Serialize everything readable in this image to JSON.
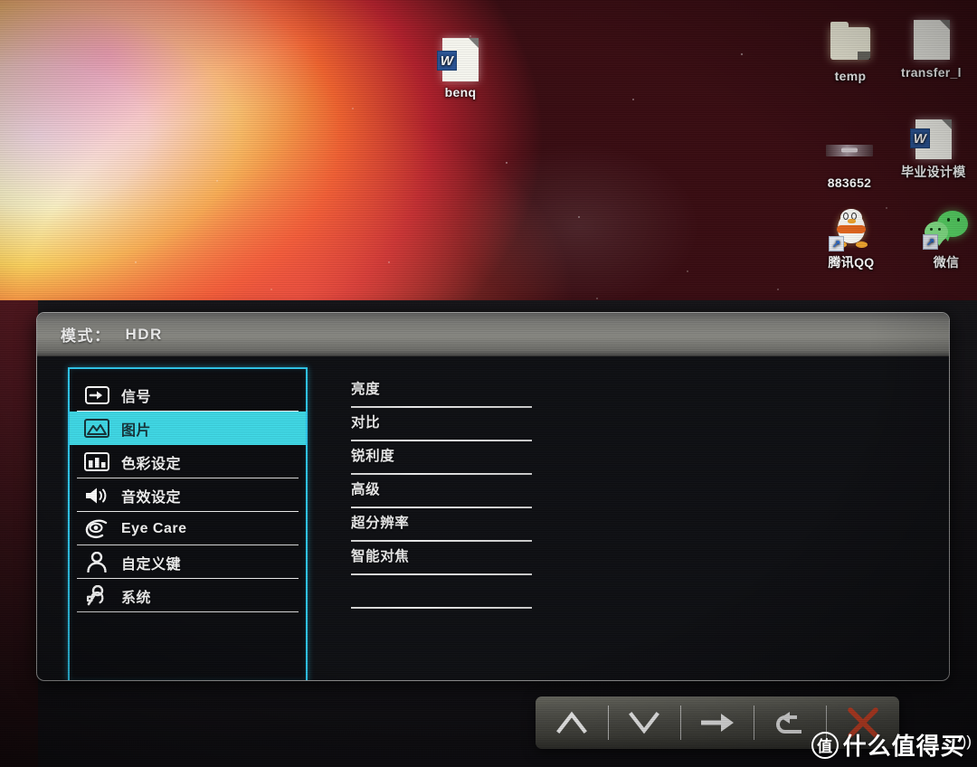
{
  "desktop": {
    "icons": [
      {
        "name": "benq",
        "label": "benq",
        "type": "word-document"
      },
      {
        "name": "temp",
        "label": "temp",
        "type": "folder"
      },
      {
        "name": "transfer",
        "label": "transfer_l",
        "type": "file"
      },
      {
        "name": "883652",
        "label": "883652",
        "type": "file-thin"
      },
      {
        "name": "graduation-doc",
        "label": "毕业设计模",
        "type": "word-document"
      },
      {
        "name": "tencent-qq",
        "label": "腾讯QQ",
        "type": "app-shortcut"
      },
      {
        "name": "wechat",
        "label": "微信",
        "type": "app-shortcut"
      }
    ]
  },
  "osd": {
    "title_label": "模式：",
    "title_value": "HDR",
    "accent_color": "#2fc9ef",
    "highlight_color": "#3fdcea",
    "sidebar": [
      {
        "label": "信号",
        "icon": "signal-icon",
        "selected": false
      },
      {
        "label": "图片",
        "icon": "picture-icon",
        "selected": true
      },
      {
        "label": "色彩设定",
        "icon": "color-settings-icon",
        "selected": false
      },
      {
        "label": "音效设定",
        "icon": "audio-settings-icon",
        "selected": false
      },
      {
        "label": "Eye Care",
        "icon": "eye-care-icon",
        "selected": false
      },
      {
        "label": "自定义键",
        "icon": "custom-key-icon",
        "selected": false
      },
      {
        "label": "系统",
        "icon": "system-wrench-icon",
        "selected": false
      }
    ],
    "options": [
      {
        "label": "亮度"
      },
      {
        "label": "对比"
      },
      {
        "label": "锐利度"
      },
      {
        "label": "高级"
      },
      {
        "label": "超分辨率"
      },
      {
        "label": "智能对焦"
      },
      {
        "label": ""
      }
    ]
  },
  "controls": [
    {
      "name": "up-button",
      "icon": "chevron-up-icon"
    },
    {
      "name": "down-button",
      "icon": "chevron-down-icon"
    },
    {
      "name": "enter-button",
      "icon": "arrow-right-icon"
    },
    {
      "name": "back-button",
      "icon": "undo-arrow-icon"
    },
    {
      "name": "exit-button",
      "icon": "close-x-icon",
      "color": "#e24a2a"
    }
  ],
  "watermark": {
    "mark": "值",
    "text": "什么值得买"
  }
}
